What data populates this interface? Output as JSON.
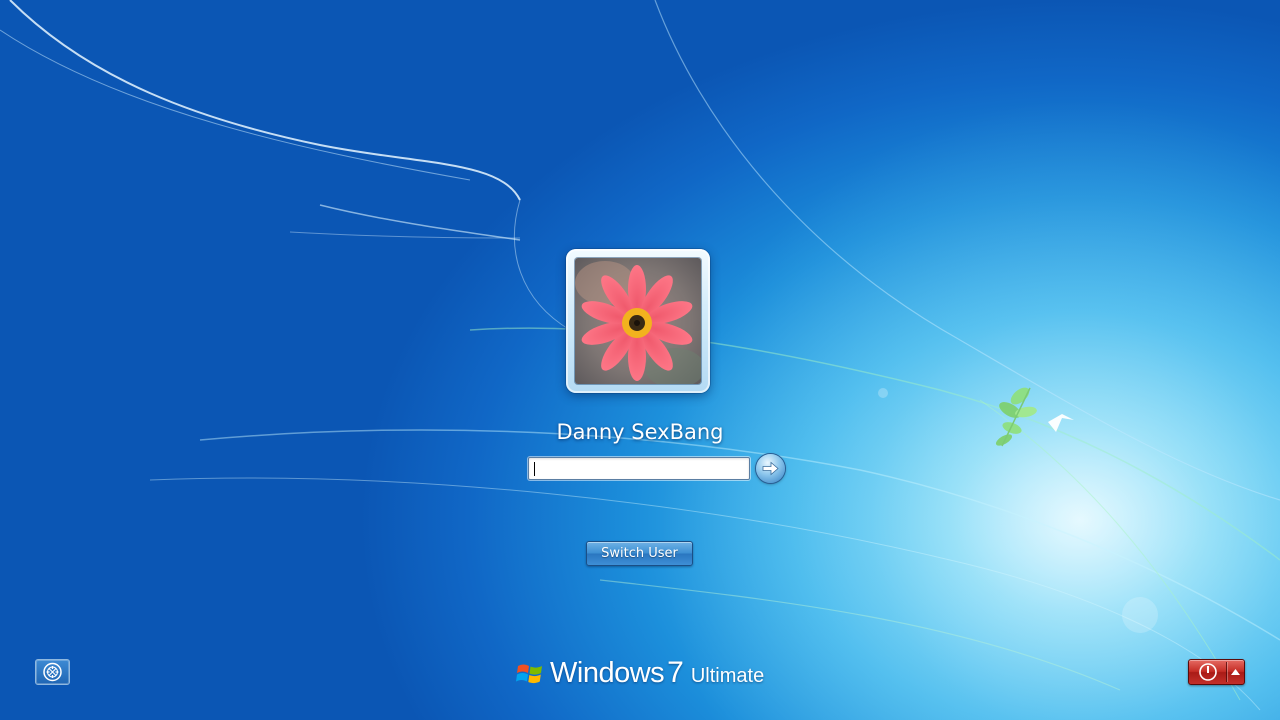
{
  "logon": {
    "user_name": "Danny SexBang",
    "password_value": "",
    "switch_user_label": "Switch User"
  },
  "branding": {
    "product": "Windows",
    "version": "7",
    "edition": "Ultimate"
  },
  "icons": {
    "avatar": "flower-avatar",
    "submit": "arrow-right-icon",
    "ease_of_access": "ease-of-access-icon",
    "shutdown": "power-icon",
    "shutdown_options": "triangle-up-icon",
    "logo": "windows-flag-icon"
  },
  "colors": {
    "background": "#1a86d6",
    "power_button": "#c42c25",
    "switch_user_button": "#3d8fd3"
  }
}
